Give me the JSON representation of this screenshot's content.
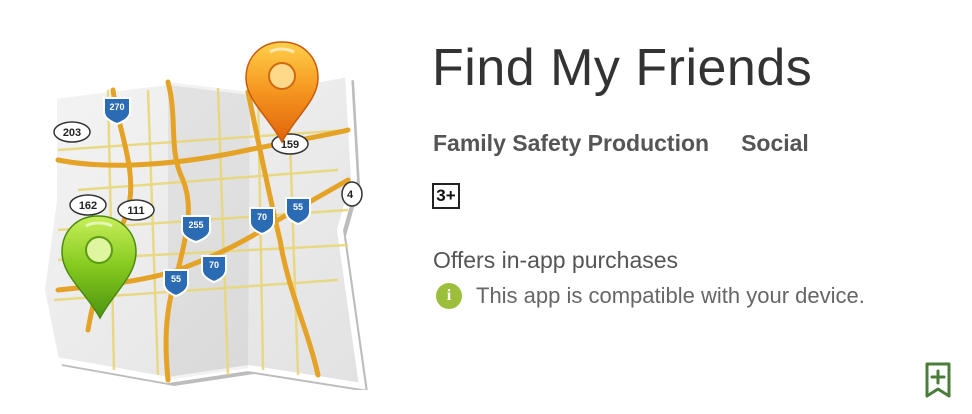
{
  "app": {
    "title": "Find My Friends",
    "developer": "Family Safety Production",
    "category": "Social",
    "content_rating": "3+",
    "offers": "Offers in-app purchases",
    "compatibility": "This app is compatible with your device."
  },
  "map_labels": {
    "r270": "270",
    "r203": "203",
    "r159": "159",
    "r162": "162",
    "r111": "111",
    "r255": "255",
    "r70a": "70",
    "r70b": "70",
    "r55a": "55",
    "r55b": "55",
    "r4": "4"
  },
  "icons": {
    "info": "info-circle-icon",
    "wishlist": "bookmark-add-icon",
    "pin_orange": "location-pin-icon",
    "pin_green": "location-pin-icon"
  },
  "colors": {
    "accent_green": "#9bbf3a",
    "wishlist_green": "#4a7c3a",
    "pin_orange": "#f08a1c",
    "pin_green": "#7cc21e"
  }
}
